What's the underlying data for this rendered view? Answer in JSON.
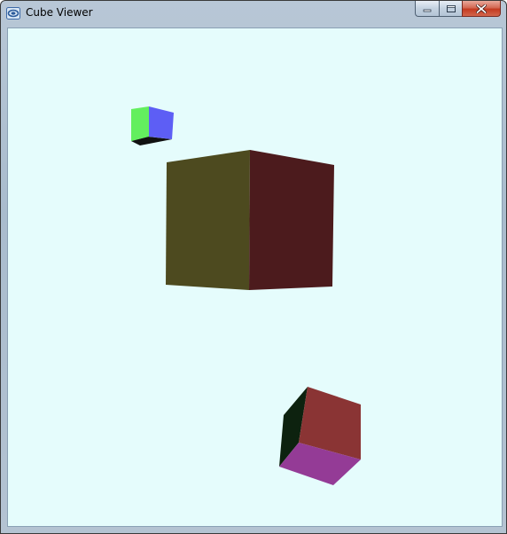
{
  "window": {
    "title": "Cube Viewer",
    "icon": "app-window-icon"
  },
  "caption_buttons": {
    "minimize_icon": "minimize-icon",
    "maximize_icon": "maximize-icon",
    "close_icon": "close-icon"
  },
  "viewport": {
    "background_color": "#e5fcfc",
    "cubes": [
      {
        "name": "small-cube",
        "faces": {
          "left": "#63ef5e",
          "right": "#5d5ef5",
          "bottom": "#111111"
        }
      },
      {
        "name": "large-cube",
        "faces": {
          "left": "#4d4a1f",
          "right": "#4c1b1d"
        }
      },
      {
        "name": "tilted-cube",
        "faces": {
          "top": "#8a3434",
          "bottom": "#943b96",
          "left": "#0d220f"
        }
      }
    ]
  }
}
